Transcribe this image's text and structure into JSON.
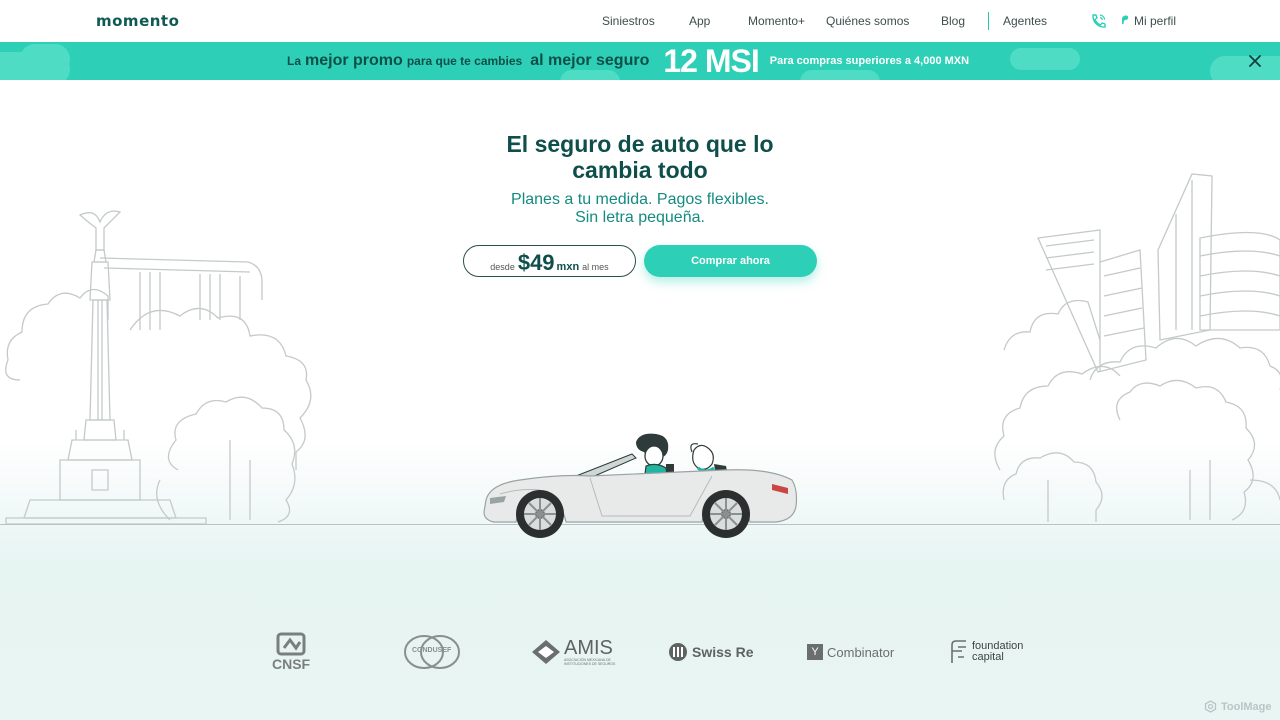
{
  "header": {
    "logo": "momento",
    "nav": [
      "Siniestros",
      "App",
      "Momento+",
      "Quiénes somos",
      "Blog",
      "Agentes"
    ],
    "profile_label": "Mi perfil",
    "phone_icon": "phone-icon",
    "accent": "#2dd0b6"
  },
  "promo": {
    "part1_small": "La",
    "part1_big": "mejor promo",
    "part2_small": "para que te cambies",
    "part2_big": "al mejor seguro",
    "msi": "12 MSI",
    "note": "Para compras superiores a 4,000 MXN",
    "close_icon": "close-icon",
    "background": "#2dd0b6"
  },
  "hero": {
    "title_line1": "El seguro de auto que lo",
    "title_line2": "cambia todo",
    "subtitle_line1": "Planes a tu medida. Pagos flexibles.",
    "subtitle_line2": "Sin letra pequeña.",
    "price_prefix": "desde",
    "price_amount": "$49",
    "price_currency": "mxn",
    "price_suffix": "al mes",
    "cta_label": "Comprar ahora"
  },
  "partners": {
    "cnsf": "CNSF",
    "condusef": "CONDUSEF",
    "amis": "AMIS",
    "amis_sub": "ASOCIACIÓN MEXICANA DE INSTITUCIONES DE SEGUROS",
    "swissre": "Swiss Re",
    "yc_letter": "Y",
    "yc_name": "Combinator",
    "fc_line1": "foundation",
    "fc_line2": "capital"
  },
  "watermark": "ToolMage"
}
